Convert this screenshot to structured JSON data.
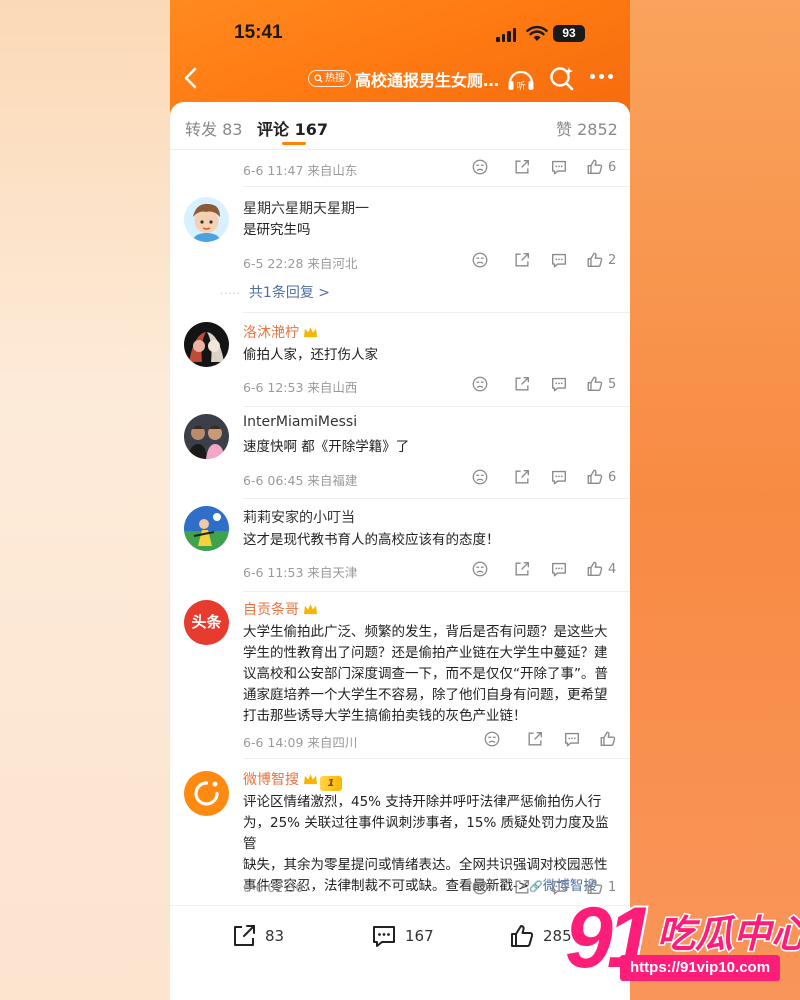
{
  "status_bar": {
    "time": "15:41",
    "battery": "93"
  },
  "nav": {
    "hot_badge": "热搜",
    "title": "高校通报男生女厕…",
    "listen_label": "听"
  },
  "tabs": {
    "repost": "转发 83",
    "comment": "评论 167",
    "likes": "赞 2852"
  },
  "comments": [
    {
      "id": "top",
      "date": "6-6 11:47 来自山东",
      "likes": "6"
    },
    {
      "id": "c1",
      "name": "星期六星期天星期一",
      "text": "是研究生吗",
      "date": "6-5 22:28 来自河北",
      "likes": "2",
      "reply": "共1条回复 >"
    },
    {
      "id": "c2",
      "name": "洛沐滟柠",
      "text": "偷拍人家，还打伤人家",
      "date": "6-6 12:53 来自山西",
      "likes": "5"
    },
    {
      "id": "c3",
      "name": "InterMiamiMessi",
      "text": "速度快啊 都《开除学籍》了",
      "date": "6-6 06:45 来自福建",
      "likes": "6"
    },
    {
      "id": "c4",
      "name": "莉莉安家的小叮当",
      "text": "这才是现代教书育人的高校应该有的态度！",
      "date": "6-6 11:53 来自天津",
      "likes": "4"
    },
    {
      "id": "c5",
      "name": "自贡条哥",
      "avatar_text": "头条",
      "lines": [
        "大学生偷拍此广泛、频繁的发生，背后是否有问题？是这些大",
        "学生的性教育出了问题？还是偷拍产业链在大学生中蔓延？建",
        "议高校和公安部门深度调查一下，而不是仅仅“开除了事”。普",
        "通家庭培养一个大学生不容易，除了他们自身有问题，更希望",
        "打击那些诱导大学生搞偷拍卖钱的灰色产业链！"
      ],
      "date": "6-6 14:09 来自四川"
    },
    {
      "id": "c6",
      "name": "微博智搜",
      "level": "1",
      "lines": [
        "评论区情绪激烈，45% 支持开除并呼吁法律严惩偷拍伤人行",
        "为，25% 关联过往事件讽刺涉事者，15% 质疑处罚力度及监管",
        "缺失，其余为零星提问或情绪表达。全网共识强调对校园恶性"
      ],
      "last_line": "事件零容忍，法律制裁不可或缺。查看最新戳->",
      "link": "微博智搜",
      "date": "6-6 02:30",
      "likes": "1"
    }
  ],
  "bottom_bar": {
    "repost": "83",
    "comment": "167",
    "like": "285"
  },
  "watermark": {
    "number": "91",
    "text": "吃瓜中心",
    "url": "https://91vip10.com"
  },
  "colors": {
    "accent": "#ff8200",
    "name_orange": "#eb7340",
    "link": "#4e6fa0",
    "watermark": "#ff1d7a"
  }
}
